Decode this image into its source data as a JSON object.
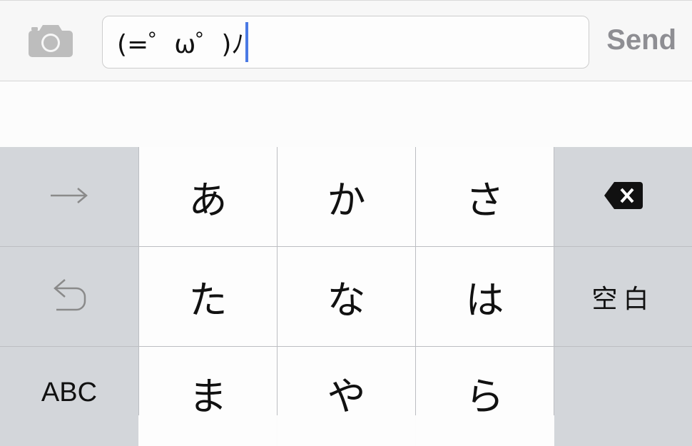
{
  "header": {
    "camera_icon": "camera-icon",
    "input_value": "(=゜ω゜)ﾉ",
    "send_label": "Send",
    "colors": {
      "caret": "#4a79e4",
      "send_text": "#8e8e93"
    }
  },
  "keyboard": {
    "rows": [
      {
        "keys": [
          {
            "type": "icon",
            "icon": "right-arrow-icon",
            "label": "→"
          },
          {
            "type": "kana",
            "label": "あ"
          },
          {
            "type": "kana",
            "label": "か"
          },
          {
            "type": "kana",
            "label": "さ"
          },
          {
            "type": "icon",
            "icon": "backspace-icon"
          }
        ]
      },
      {
        "keys": [
          {
            "type": "icon",
            "icon": "undo-icon"
          },
          {
            "type": "kana",
            "label": "た"
          },
          {
            "type": "kana",
            "label": "な"
          },
          {
            "type": "kana",
            "label": "は"
          },
          {
            "type": "text",
            "label": "空白"
          }
        ]
      },
      {
        "keys": [
          {
            "type": "text",
            "label": "ABC"
          },
          {
            "type": "kana",
            "label": "ま"
          },
          {
            "type": "kana",
            "label": "や"
          },
          {
            "type": "kana",
            "label": "ら"
          },
          {
            "type": "blank"
          }
        ]
      }
    ],
    "colors": {
      "side_key": "#d3d6da",
      "center_key": "#fdfdfd",
      "separator": "#bcbec2"
    }
  }
}
